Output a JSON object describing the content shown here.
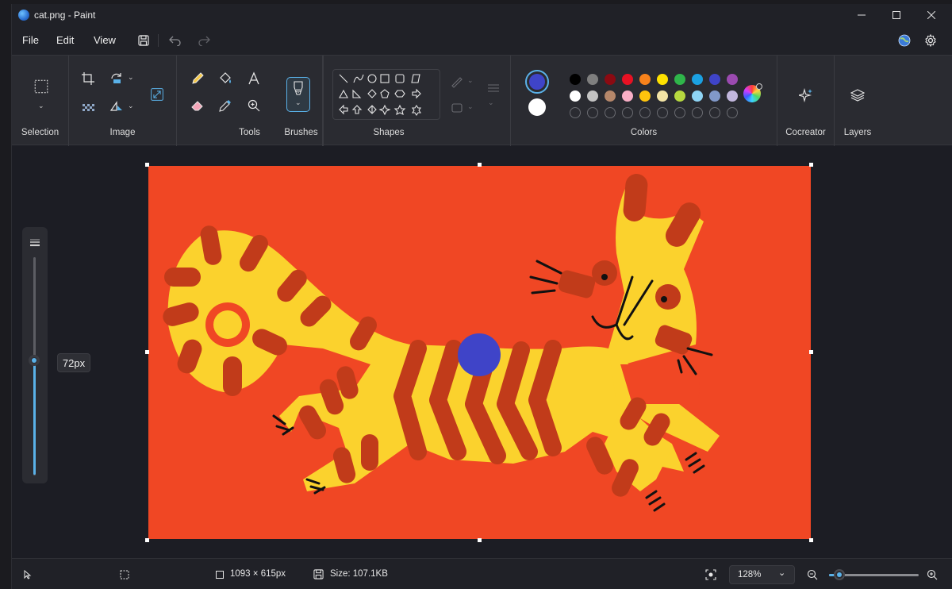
{
  "window": {
    "title": "cat.png - Paint"
  },
  "menu": {
    "file": "File",
    "edit": "Edit",
    "view": "View"
  },
  "ribbon": {
    "groups": {
      "selection": "Selection",
      "image": "Image",
      "tools": "Tools",
      "brushes": "Brushes",
      "shapes": "Shapes",
      "colors": "Colors",
      "cocreator": "Cocreator",
      "layers": "Layers"
    },
    "primary_color": "#3f44c8",
    "secondary_color": "#ffffff",
    "palette": [
      [
        "#000000",
        "#7f7f7f",
        "#8b0a12",
        "#e81123",
        "#f7821b",
        "#fee100",
        "#2fb54a",
        "#1ba1e2",
        "#3f44c8",
        "#9b4ab0"
      ],
      [
        "#ffffff",
        "#c3c3c3",
        "#b5876a",
        "#f9afc6",
        "#ffc40d",
        "#f3e4a6",
        "#b6d83f",
        "#8fd5f5",
        "#8199c9",
        "#c2b7dd"
      ]
    ],
    "custom_slots": 10
  },
  "brush_size": {
    "label": "72px",
    "level_fraction": 0.47
  },
  "canvas": {
    "background_color": "#f04724"
  },
  "status": {
    "canvas_size": "1093 × 615px",
    "file_size": "Size: 107.1KB",
    "zoom": "128%",
    "zoom_fraction": 0.12
  }
}
